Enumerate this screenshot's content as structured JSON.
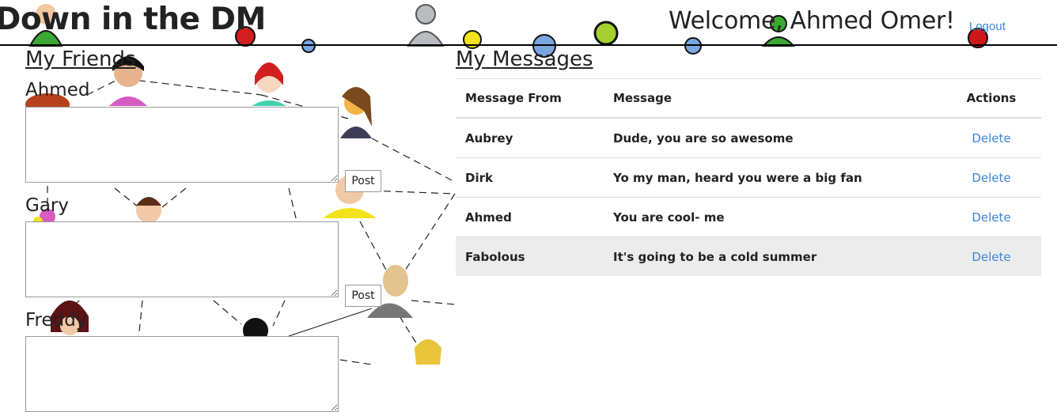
{
  "header": {
    "site_title": "Down in the DM",
    "welcome": "Welcome, Ahmed Omer!",
    "logout": "Logout"
  },
  "friends_panel": {
    "title": "My Friends",
    "post_label": "Post",
    "friends": [
      {
        "name": "Ahmed",
        "message": ""
      },
      {
        "name": "Gary",
        "message": ""
      },
      {
        "name": "Freddy",
        "message": ""
      }
    ]
  },
  "messages_panel": {
    "title": "My Messages",
    "columns": [
      "Message From",
      "Message",
      "Actions"
    ],
    "rows": [
      {
        "from": "Aubrey",
        "message": "Dude, you are so awesome",
        "action": "Delete"
      },
      {
        "from": "Dirk",
        "message": "Yo my man, heard you were a big fan",
        "action": "Delete"
      },
      {
        "from": "Ahmed",
        "message": "You are cool- me",
        "action": "Delete"
      },
      {
        "from": "Fabolous",
        "message": "It's going to be a cold summer",
        "action": "Delete"
      }
    ]
  },
  "background": {
    "avatar_colors": [
      "#3aa832",
      "#d11f1f",
      "#b9bcc0",
      "#f2e31a",
      "#7aa6e0",
      "#a4cf2e",
      "#c9d3e0",
      "#111111",
      "#d01717",
      "#b5421c",
      "#f4d38a",
      "#e9c43a"
    ]
  }
}
